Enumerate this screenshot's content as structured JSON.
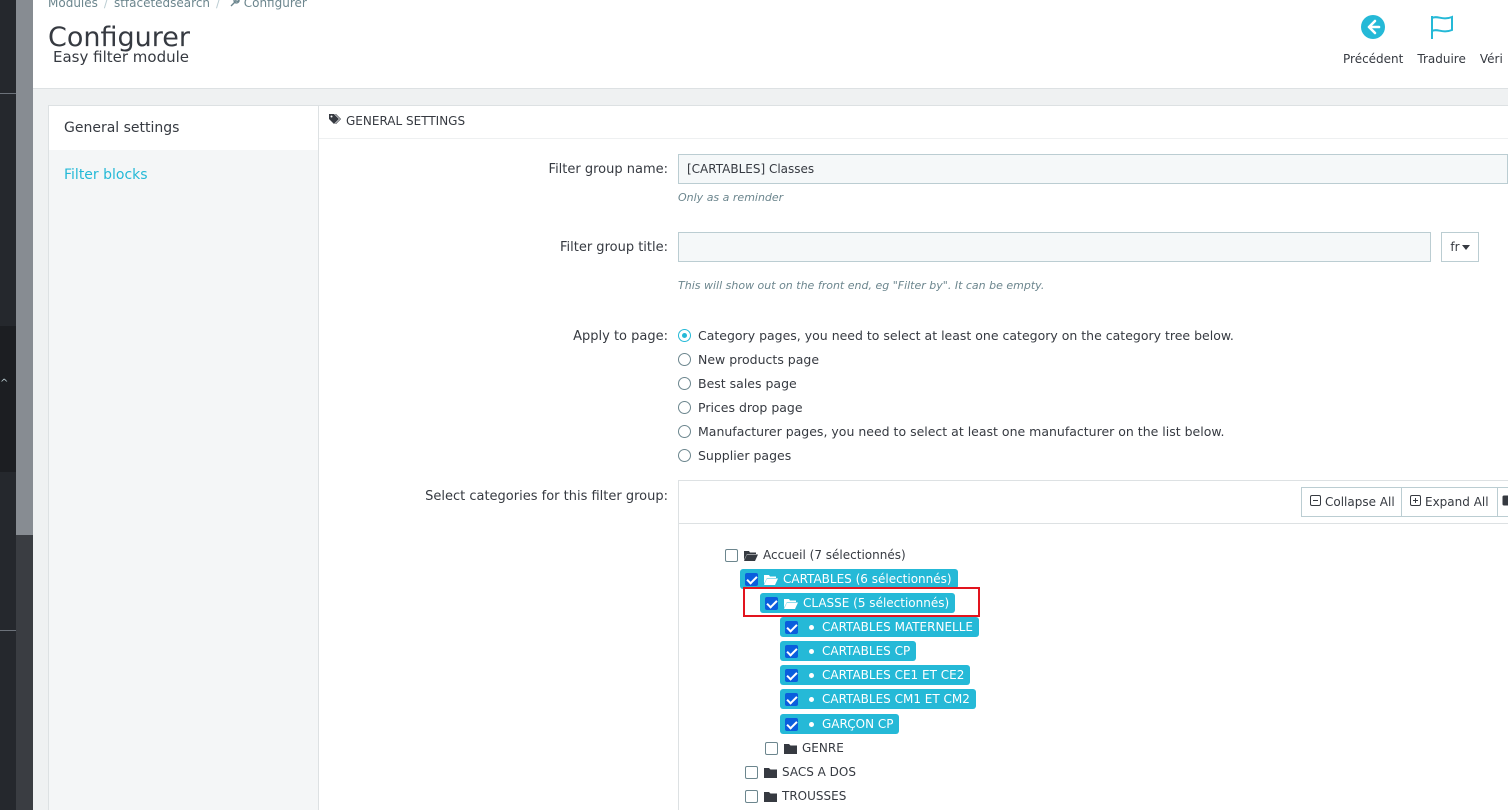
{
  "breadcrumb": {
    "items": [
      "Modules",
      "stfacetedsearch",
      "Configurer"
    ]
  },
  "header": {
    "title": "Configurer",
    "subtitle": "Easy filter module"
  },
  "toolbar": {
    "previous": "Précédent",
    "translate": "Traduire",
    "check": "Véri"
  },
  "nav": {
    "general": "General settings",
    "filter_blocks": "Filter blocks"
  },
  "panel": {
    "heading": "GENERAL SETTINGS"
  },
  "form": {
    "group_name_label": "Filter group name:",
    "group_name_value": "[CARTABLES] Classes",
    "group_name_help": "Only as a reminder",
    "group_title_label": "Filter group title:",
    "group_title_value": "",
    "group_title_help": "This will show out on the front end, eg \"Filter by\". It can be empty.",
    "lang": "fr",
    "apply_label": "Apply to page:",
    "apply_options": [
      "Category pages, you need to select at least one category on the category tree below.",
      "New products page",
      "Best sales page",
      "Prices drop page",
      "Manufacturer pages, you need to select at least one manufacturer on the list below.",
      "Supplier pages"
    ],
    "categories_label": "Select categories for this filter group:"
  },
  "tree": {
    "collapse_all": "Collapse All",
    "expand_all": "Expand All",
    "nodes": [
      "Accueil (7 sélectionnés)",
      "CARTABLES (6 sélectionnés)",
      "CLASSE (5 sélectionnés)",
      "CARTABLES MATERNELLE",
      "CARTABLES CP",
      "CARTABLES CE1 ET CE2",
      "CARTABLES CM1 ET CM2",
      "GARÇON CP",
      "GENRE",
      "SACS A DOS",
      "TROUSSES"
    ]
  },
  "colors": {
    "accent": "#25b9d7",
    "checkbox": "#0a5edd",
    "highlight": "#e2141e"
  }
}
